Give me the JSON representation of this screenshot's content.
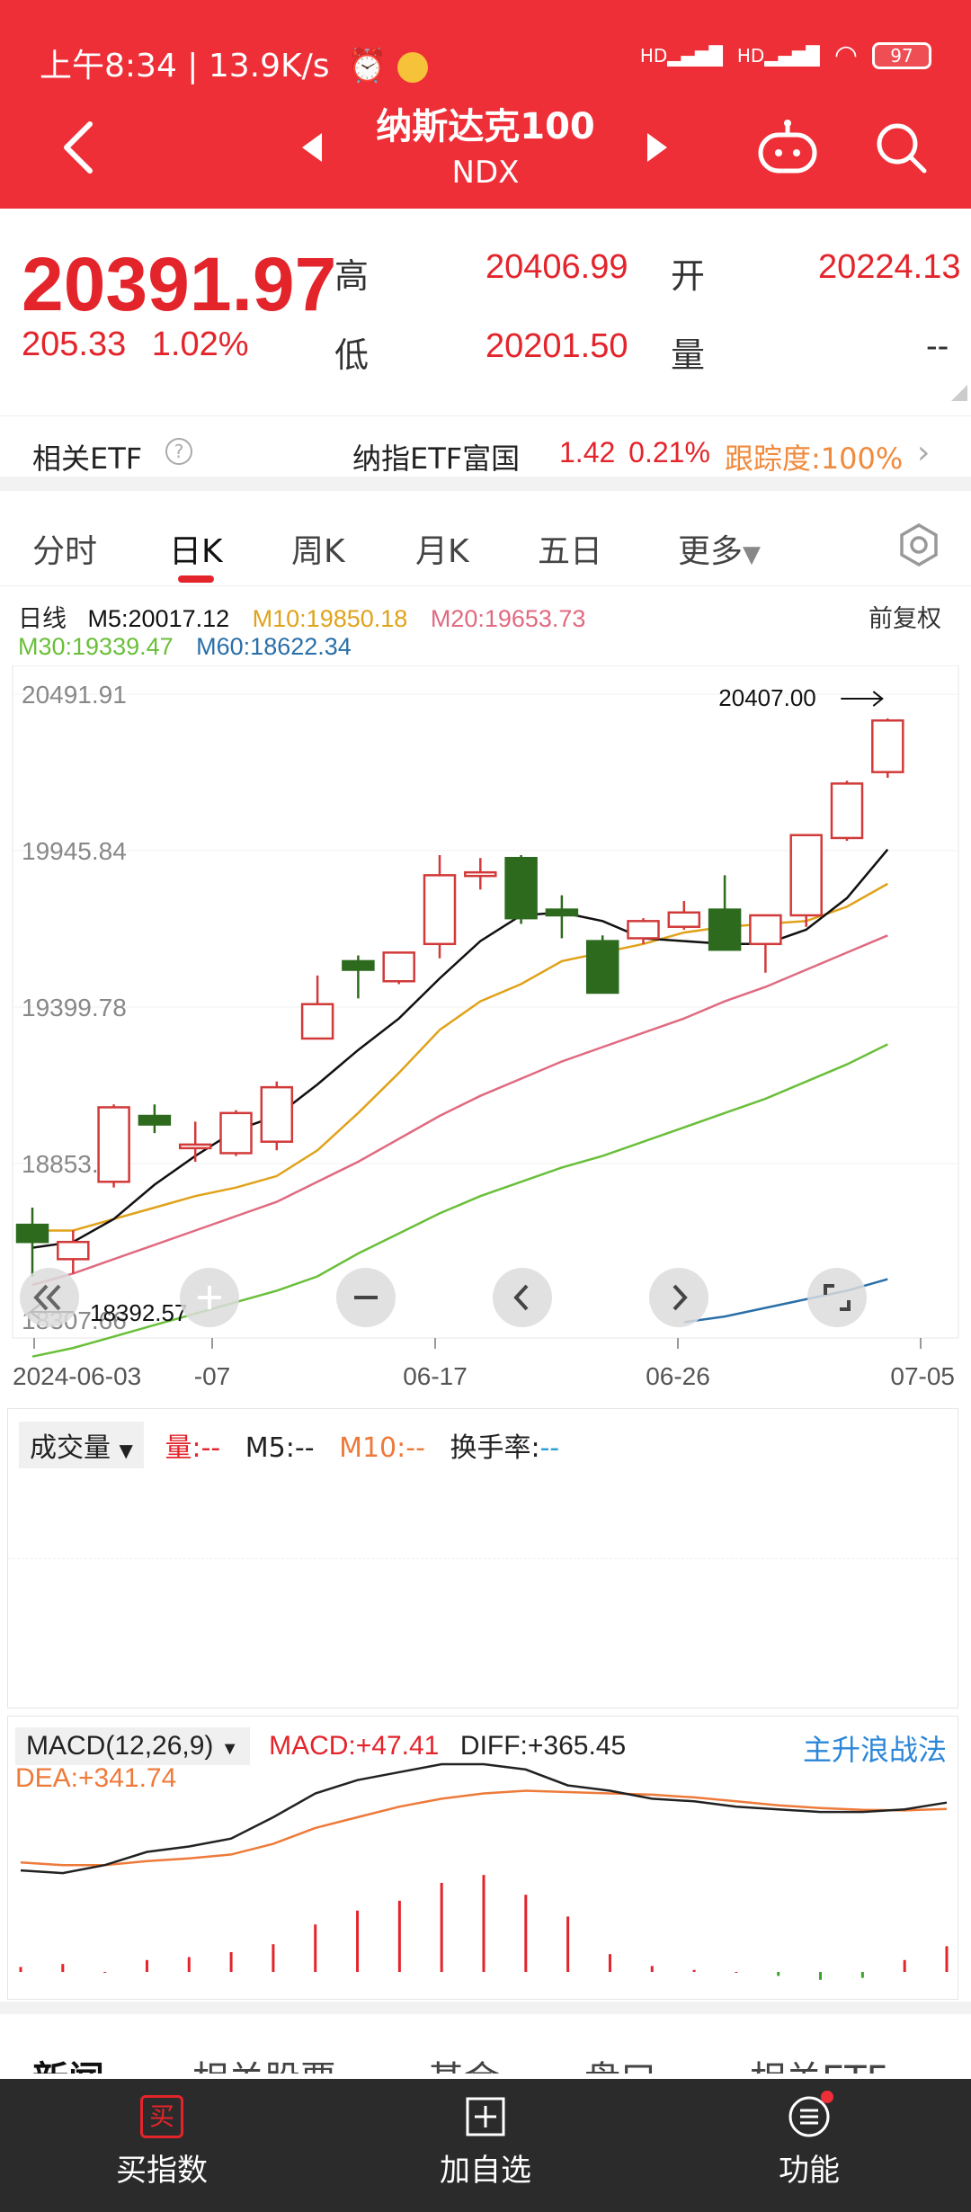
{
  "status": {
    "time": "上午8:34 | 13.9K/s",
    "battery": "97",
    "signal": "HD"
  },
  "header": {
    "title": "纳斯达克100",
    "code": "NDX"
  },
  "quote": {
    "price": "20391.97",
    "change": "205.33",
    "change_pct": "1.02%",
    "high_label": "高",
    "high": "20406.99",
    "open_label": "开",
    "open": "20224.13",
    "low_label": "低",
    "low": "20201.50",
    "volume_label": "量",
    "volume": "--"
  },
  "etf": {
    "title": "相关ETF",
    "help": "?",
    "name": "纳指ETF富国",
    "price": "1.42",
    "pct": "0.21%",
    "tracking": "跟踪度:100%"
  },
  "tabs": [
    "分时",
    "日K",
    "周K",
    "月K",
    "五日",
    "更多"
  ],
  "ma": {
    "label": "日线",
    "m5": "M5:20017.12",
    "m10": "M10:19850.18",
    "m20": "M20:19653.73",
    "m30": "M30:19339.47",
    "m60": "M60:18622.34",
    "adjust": "前复权"
  },
  "colors": {
    "up": "#d23a3a",
    "down": "#2d6a1e",
    "m5": "#111111",
    "m10": "#e0a21a",
    "m20": "#e06a80",
    "m30": "#6abf3a",
    "m60": "#2a6fa8",
    "macd": "#222222",
    "dea": "#ee7a3a",
    "red_header": "#ee2f38"
  },
  "kchart": {
    "y_labels": [
      "20491.91",
      "19945.84",
      "19399.78",
      "18853.72",
      "18307.66"
    ],
    "max_marker": "20407.00",
    "min_marker": "18392.57",
    "x_labels": [
      "2024-06-03",
      "-07",
      "06-17",
      "06-26",
      "07-05"
    ],
    "controls": [
      "back-double-icon",
      "zoom-in-icon",
      "zoom-out-icon",
      "pan-left-icon",
      "pan-right-icon",
      "fullscreen-icon"
    ]
  },
  "chart_data": {
    "type": "candlestick",
    "ylim": [
      18307.66,
      20491.91
    ],
    "candles": [
      {
        "o": 18640,
        "c": 18580,
        "h": 18700,
        "l": 18460
      },
      {
        "o": 18520,
        "c": 18580,
        "h": 18620,
        "l": 18470
      },
      {
        "o": 18790,
        "c": 19050,
        "h": 19060,
        "l": 18770
      },
      {
        "o": 19020,
        "c": 18990,
        "h": 19060,
        "l": 18960
      },
      {
        "o": 18920,
        "c": 18920,
        "h": 19000,
        "l": 18860
      },
      {
        "o": 18890,
        "c": 19030,
        "h": 19040,
        "l": 18880
      },
      {
        "o": 18930,
        "c": 19120,
        "h": 19140,
        "l": 18900
      },
      {
        "o": 19290,
        "c": 19410,
        "h": 19510,
        "l": 19290
      },
      {
        "o": 19560,
        "c": 19530,
        "h": 19580,
        "l": 19430
      },
      {
        "o": 19490,
        "c": 19590,
        "h": 19590,
        "l": 19480
      },
      {
        "o": 19620,
        "c": 19860,
        "h": 19930,
        "l": 19570
      },
      {
        "o": 19870,
        "c": 19870,
        "h": 19920,
        "l": 19810
      },
      {
        "o": 19920,
        "c": 19710,
        "h": 19930,
        "l": 19690
      },
      {
        "o": 19740,
        "c": 19720,
        "h": 19790,
        "l": 19640
      },
      {
        "o": 19630,
        "c": 19450,
        "h": 19650,
        "l": 19450
      },
      {
        "o": 19640,
        "c": 19700,
        "h": 19710,
        "l": 19620
      },
      {
        "o": 19680,
        "c": 19730,
        "h": 19770,
        "l": 19670
      },
      {
        "o": 19740,
        "c": 19600,
        "h": 19860,
        "l": 19600
      },
      {
        "o": 19620,
        "c": 19720,
        "h": 19720,
        "l": 19520
      },
      {
        "o": 19720,
        "c": 20000,
        "h": 20000,
        "l": 19680
      },
      {
        "o": 19990,
        "c": 20180,
        "h": 20190,
        "l": 19980
      },
      {
        "o": 20220,
        "c": 20400,
        "h": 20407,
        "l": 20200
      }
    ],
    "m5": [
      18560,
      18580,
      18660,
      18780,
      18880,
      18970,
      19020,
      19130,
      19250,
      19360,
      19500,
      19630,
      19720,
      19730,
      19700,
      19640,
      19630,
      19620,
      19620,
      19670,
      19780,
      19950
    ],
    "m10": [
      18620,
      18620,
      18660,
      18700,
      18740,
      18770,
      18810,
      18900,
      19030,
      19170,
      19320,
      19420,
      19480,
      19560,
      19590,
      19620,
      19660,
      19680,
      19690,
      19700,
      19750,
      19830
    ],
    "m20": [
      18430,
      18470,
      18520,
      18570,
      18620,
      18670,
      18720,
      18790,
      18860,
      18940,
      19020,
      19090,
      19150,
      19210,
      19260,
      19310,
      19360,
      19420,
      19470,
      19530,
      19590,
      19650
    ],
    "m30": [
      18180,
      18210,
      18250,
      18290,
      18330,
      18370,
      18410,
      18460,
      18540,
      18610,
      18680,
      18740,
      18790,
      18840,
      18880,
      18930,
      18980,
      19030,
      19080,
      19140,
      19200,
      19270
    ],
    "m60": [
      null,
      null,
      null,
      null,
      null,
      null,
      null,
      null,
      null,
      null,
      null,
      null,
      null,
      null,
      null,
      null,
      18300,
      18320,
      18350,
      18380,
      18410,
      18450
    ],
    "macd_bars": [
      5,
      8,
      0,
      12,
      15,
      20,
      28,
      48,
      62,
      72,
      90,
      98,
      78,
      56,
      18,
      6,
      2,
      0,
      -4,
      -8,
      -6,
      12,
      26
    ],
    "diff": [
      110,
      100,
      130,
      180,
      200,
      230,
      310,
      400,
      450,
      480,
      510,
      510,
      490,
      430,
      410,
      380,
      370,
      350,
      340,
      330,
      330,
      340,
      365.45
    ],
    "dea": [
      140,
      130,
      130,
      145,
      155,
      170,
      210,
      270,
      310,
      350,
      380,
      400,
      410,
      405,
      400,
      395,
      385,
      370,
      355,
      345,
      338,
      336,
      341.74
    ]
  },
  "volume": {
    "selector": "成交量",
    "vol": "量:--",
    "m5": "M5:--",
    "m10": "M10:--",
    "turnover_label": "换手率:",
    "turnover": "--"
  },
  "macd": {
    "selector": "MACD(12,26,9)",
    "macd": "MACD:+47.41",
    "diff": "DIFF:+365.45",
    "dea": "DEA:+341.74",
    "strategy": "主升浪战法"
  },
  "news_tabs": [
    "新闻",
    "相关股票",
    "基金",
    "盘口",
    "相关ETF"
  ],
  "bottom": {
    "buy": "买指数",
    "add": "加自选",
    "func": "功能",
    "buy_icon_text": "买"
  }
}
